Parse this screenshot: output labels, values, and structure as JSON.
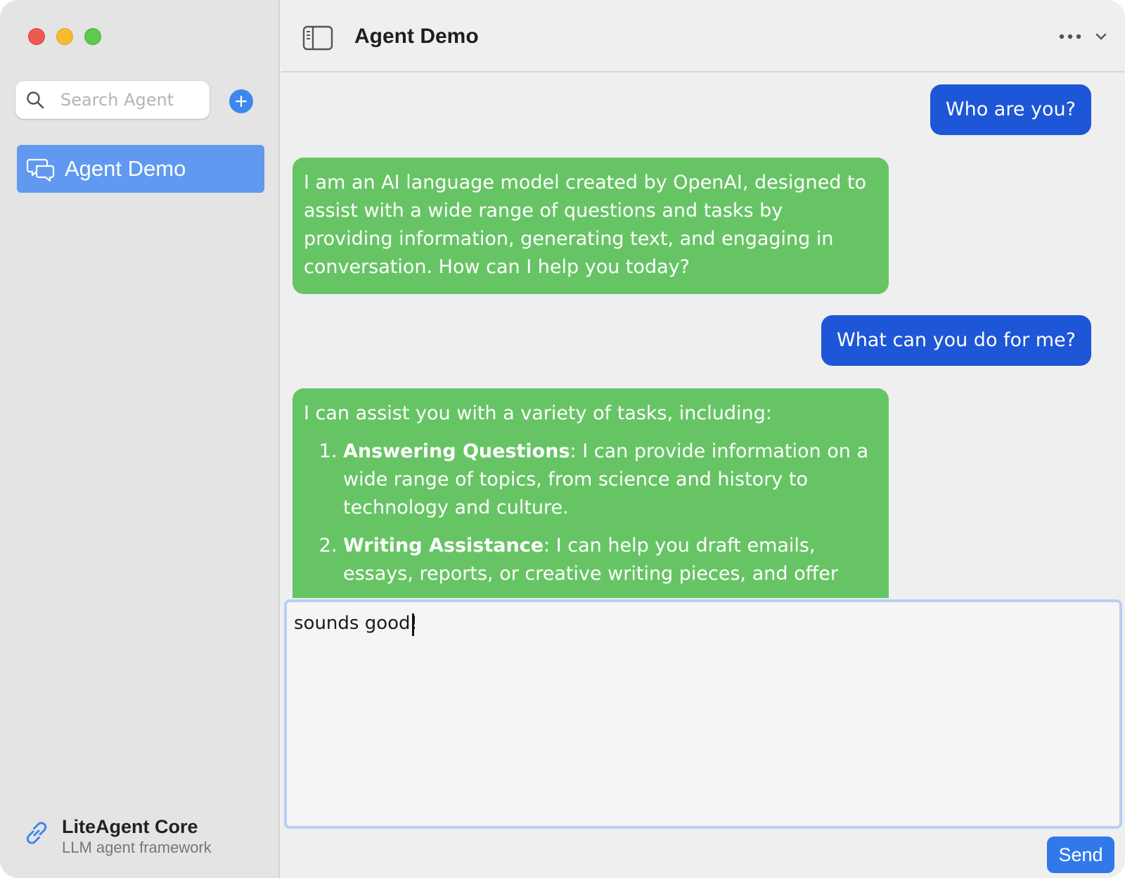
{
  "sidebar": {
    "search": {
      "placeholder": "Search Agent",
      "value": ""
    },
    "agents": [
      {
        "label": "Agent Demo",
        "icon": "chat-bubbles-icon",
        "selected": true
      }
    ],
    "footer": {
      "title": "LiteAgent Core",
      "subtitle": "LLM agent framework",
      "icon": "link-icon"
    }
  },
  "header": {
    "title": "Agent Demo"
  },
  "messages": [
    {
      "role": "user",
      "text": "Who are you?"
    },
    {
      "role": "assistant",
      "text": "I am an AI language model created by OpenAI, designed to assist with a wide range of questions and tasks by providing information, generating text, and engaging in conversation. How can I help you today?"
    },
    {
      "role": "user",
      "text": "What can you do for me?"
    },
    {
      "role": "assistant",
      "intro": "I can assist you with a variety of tasks, including:",
      "items": [
        {
          "title": "Answering Questions",
          "text": ": I can provide information on a wide range of topics, from science and history to technology and culture."
        },
        {
          "title": "Writing Assistance",
          "text": ": I can help you draft emails, essays, reports, or creative writing pieces, and offer"
        }
      ]
    }
  ],
  "composer": {
    "value": "sounds good!"
  },
  "send_label": "Send",
  "colors": {
    "user_bubble": "#1d56d6",
    "assistant_bubble": "#67c465",
    "selected_item": "#6199f0",
    "accent": "#3179ea"
  }
}
